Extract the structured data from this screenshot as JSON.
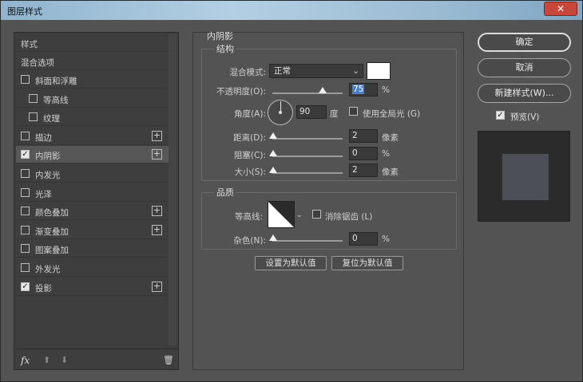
{
  "window": {
    "title": "图层样式",
    "close_symbol": "✕"
  },
  "left_panel": {
    "header": "样式",
    "blend_options": "混合选项",
    "items": [
      {
        "label": "斜面和浮雕",
        "checked": false,
        "has_plus": false,
        "indent": 0
      },
      {
        "label": "等高线",
        "checked": false,
        "has_plus": false,
        "indent": 1
      },
      {
        "label": "纹理",
        "checked": false,
        "has_plus": false,
        "indent": 1
      },
      {
        "label": "描边",
        "checked": false,
        "has_plus": true,
        "indent": 0
      },
      {
        "label": "内阴影",
        "checked": true,
        "has_plus": true,
        "indent": 0,
        "selected": true
      },
      {
        "label": "内发光",
        "checked": false,
        "has_plus": false,
        "indent": 0
      },
      {
        "label": "光泽",
        "checked": false,
        "has_plus": false,
        "indent": 0
      },
      {
        "label": "颜色叠加",
        "checked": false,
        "has_plus": true,
        "indent": 0
      },
      {
        "label": "渐变叠加",
        "checked": false,
        "has_plus": true,
        "indent": 0
      },
      {
        "label": "图案叠加",
        "checked": false,
        "has_plus": false,
        "indent": 0
      },
      {
        "label": "外发光",
        "checked": false,
        "has_plus": false,
        "indent": 0
      },
      {
        "label": "投影",
        "checked": true,
        "has_plus": true,
        "indent": 0
      }
    ],
    "footer": {
      "fx": "fx",
      "up": "⬆",
      "down": "⬇",
      "trash": "🗑"
    }
  },
  "inner_shadow": {
    "section_title": "内阴影",
    "structure": {
      "title": "结构",
      "blend_mode_label": "混合模式:",
      "blend_mode_value": "正常",
      "opacity_label": "不透明度(O):",
      "opacity_value": "75",
      "opacity_unit": "%",
      "angle_label": "角度(A):",
      "angle_value": "90",
      "angle_unit": "度",
      "global_light_label": "使用全局光 (G)",
      "global_light_checked": false,
      "distance_label": "距离(D):",
      "distance_value": "2",
      "distance_unit": "像素",
      "choke_label": "阻塞(C):",
      "choke_value": "0",
      "choke_unit": "%",
      "size_label": "大小(S):",
      "size_value": "2",
      "size_unit": "像素"
    },
    "quality": {
      "title": "品质",
      "contour_label": "等高线:",
      "antialias_label": "消除锯齿 (L)",
      "antialias_checked": false,
      "noise_label": "杂色(N):",
      "noise_value": "0",
      "noise_unit": "%"
    },
    "make_default": "设置为默认值",
    "reset_default": "复位为默认值"
  },
  "right_panel": {
    "ok": "确定",
    "cancel": "取消",
    "new_style": "新建样式(W)...",
    "preview_label": "预览(V)",
    "preview_checked": true
  },
  "colors": {
    "shadow_swatch": "#ffffff",
    "selection_highlight": "#4a7fcf"
  }
}
